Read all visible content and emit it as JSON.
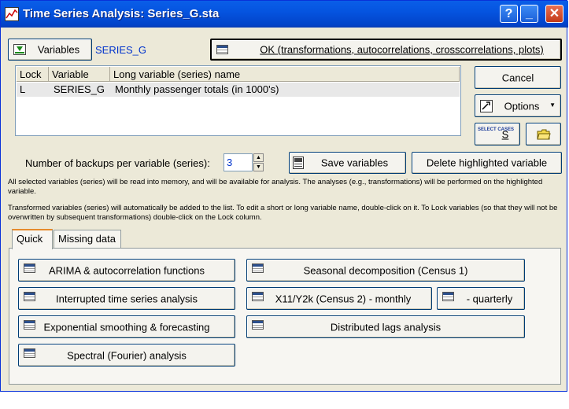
{
  "window": {
    "title": "Time Series Analysis: Series_G.sta"
  },
  "titlebar_buttons": {
    "help": "?",
    "minimize": "_",
    "close": "✕"
  },
  "variables_button": "Variables",
  "selected_variable": "SERIES_G",
  "ok_button": "OK (transformations, autocorrelations, crosscorrelations, plots)",
  "cancel_button": "Cancel",
  "options_button": "Options",
  "select_cases": {
    "icon_text": "SELECT CASES",
    "label": "S"
  },
  "list": {
    "columns": [
      "Lock",
      "Variable",
      "Long variable (series) name"
    ],
    "rows": [
      {
        "lock": "L",
        "variable": "SERIES_G",
        "name": "Monthly passenger totals (in 1000's)"
      }
    ]
  },
  "backups": {
    "label": "Number of backups per variable (series):",
    "value": "3"
  },
  "save_variables_button": "Save variables",
  "delete_button": "Delete highlighted variable",
  "info1": "All selected variables (series) will be read into memory, and will be available for analysis. The analyses (e.g., transformations) will be performed on the highlighted variable.",
  "info2": "Transformed variables (series) will automatically be added to the list. To edit a short or long variable name, double-click on it. To Lock variables (so that they will not be overwritten by subsequent transformations) double-click on the Lock column.",
  "tabs": [
    "Quick",
    "Missing data"
  ],
  "analysis_buttons": {
    "arima": "ARIMA & autocorrelation functions",
    "interrupted": "Interrupted time series analysis",
    "exponential": "Exponential smoothing & forecasting",
    "spectral": "Spectral (Fourier) analysis",
    "seasonal": "Seasonal decomposition (Census 1)",
    "x11_monthly": "X11/Y2k (Census 2) - monthly",
    "x11_quarterly": "- quarterly",
    "distributed": "Distributed lags analysis"
  }
}
